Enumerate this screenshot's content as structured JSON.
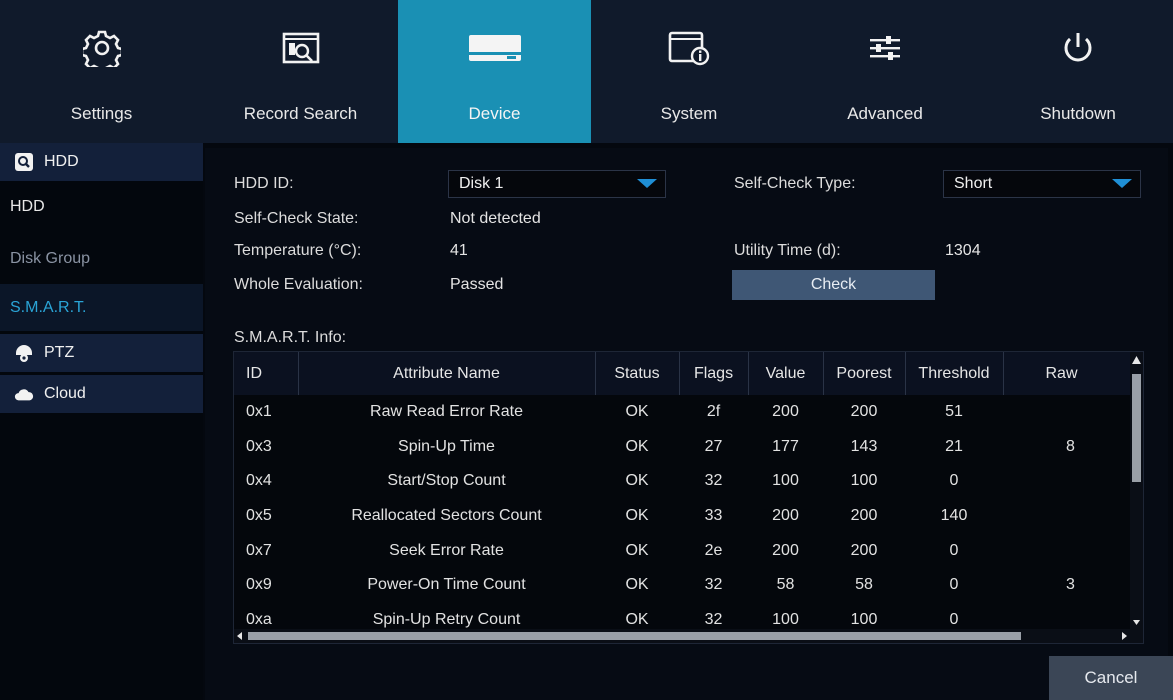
{
  "nav": {
    "items": [
      {
        "label": "Settings",
        "icon": "gear-icon"
      },
      {
        "label": "Record Search",
        "icon": "record-search-icon"
      },
      {
        "label": "Device",
        "icon": "hard-drive-icon"
      },
      {
        "label": "System",
        "icon": "system-info-icon"
      },
      {
        "label": "Advanced",
        "icon": "sliders-icon"
      },
      {
        "label": "Shutdown",
        "icon": "power-icon"
      }
    ],
    "active": "Device"
  },
  "sidebar": {
    "hdd_group": "HDD",
    "hdd_sub": "HDD",
    "disk_group_sub": "Disk Group",
    "smart_sub": "S.M.A.R.T.",
    "ptz_group": "PTZ",
    "cloud_group": "Cloud"
  },
  "form": {
    "hdd_id_label": "HDD ID:",
    "hdd_id_value": "Disk 1",
    "self_check_type_label": "Self-Check Type:",
    "self_check_type_value": "Short",
    "self_check_state_label": "Self-Check State:",
    "self_check_state_value": "Not detected",
    "temperature_label": "Temperature (°C):",
    "temperature_value": "41",
    "utility_time_label": "Utility Time (d):",
    "utility_time_value": "1304",
    "whole_eval_label": "Whole Evaluation:",
    "whole_eval_value": "Passed",
    "check_button": "Check",
    "smart_info_label": "S.M.A.R.T. Info:"
  },
  "table": {
    "headers": {
      "id": "ID",
      "name": "Attribute Name",
      "status": "Status",
      "flags": "Flags",
      "value": "Value",
      "poorest": "Poorest",
      "threshold": "Threshold",
      "raw": "Raw"
    },
    "rows": [
      {
        "id": "0x1",
        "name": "Raw Read Error Rate",
        "status": "OK",
        "flags": "2f",
        "value": "200",
        "poorest": "200",
        "threshold": "51",
        "raw": ""
      },
      {
        "id": "0x3",
        "name": "Spin-Up Time",
        "status": "OK",
        "flags": "27",
        "value": "177",
        "poorest": "143",
        "threshold": "21",
        "raw": "8"
      },
      {
        "id": "0x4",
        "name": "Start/Stop Count",
        "status": "OK",
        "flags": "32",
        "value": "100",
        "poorest": "100",
        "threshold": "0",
        "raw": ""
      },
      {
        "id": "0x5",
        "name": "Reallocated Sectors Count",
        "status": "OK",
        "flags": "33",
        "value": "200",
        "poorest": "200",
        "threshold": "140",
        "raw": ""
      },
      {
        "id": "0x7",
        "name": "Seek Error Rate",
        "status": "OK",
        "flags": "2e",
        "value": "200",
        "poorest": "200",
        "threshold": "0",
        "raw": ""
      },
      {
        "id": "0x9",
        "name": "Power-On Time Count",
        "status": "OK",
        "flags": "32",
        "value": "58",
        "poorest": "58",
        "threshold": "0",
        "raw": "3"
      },
      {
        "id": "0xa",
        "name": "Spin-Up Retry Count",
        "status": "OK",
        "flags": "32",
        "value": "100",
        "poorest": "100",
        "threshold": "0",
        "raw": ""
      }
    ]
  },
  "cancel_button": "Cancel",
  "colors": {
    "accent": "#1a90b4",
    "nav_bg": "#101a2b",
    "selected_text": "#2aa4d6",
    "dropdown_arrow": "#1f8fd6"
  }
}
